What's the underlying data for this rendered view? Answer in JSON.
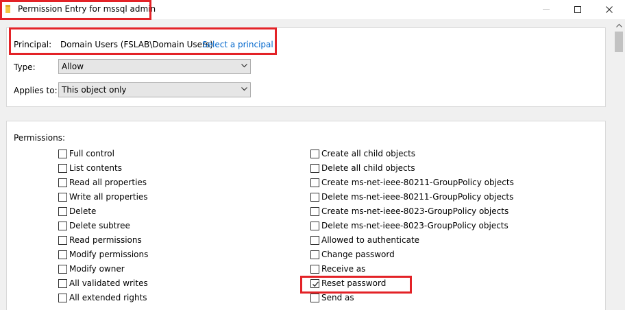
{
  "window": {
    "title": "Permission Entry for mssql admin"
  },
  "principal": {
    "label": "Principal:",
    "value": "Domain Users (FSLAB\\Domain Users)",
    "link": "Select a principal"
  },
  "type": {
    "label": "Type:",
    "value": "Allow"
  },
  "applies_to": {
    "label": "Applies to:",
    "value": "This object only"
  },
  "permissions": {
    "label": "Permissions:",
    "left": [
      {
        "label": "Full control",
        "checked": false
      },
      {
        "label": "List contents",
        "checked": false
      },
      {
        "label": "Read all properties",
        "checked": false
      },
      {
        "label": "Write all properties",
        "checked": false
      },
      {
        "label": "Delete",
        "checked": false
      },
      {
        "label": "Delete subtree",
        "checked": false
      },
      {
        "label": "Read permissions",
        "checked": false
      },
      {
        "label": "Modify permissions",
        "checked": false
      },
      {
        "label": "Modify owner",
        "checked": false
      },
      {
        "label": "All validated writes",
        "checked": false
      },
      {
        "label": "All extended rights",
        "checked": false
      }
    ],
    "right": [
      {
        "label": "Create all child objects",
        "checked": false
      },
      {
        "label": "Delete all child objects",
        "checked": false
      },
      {
        "label": "Create ms-net-ieee-80211-GroupPolicy objects",
        "checked": false
      },
      {
        "label": "Delete ms-net-ieee-80211-GroupPolicy objects",
        "checked": false
      },
      {
        "label": "Create ms-net-ieee-8023-GroupPolicy objects",
        "checked": false
      },
      {
        "label": "Delete ms-net-ieee-8023-GroupPolicy objects",
        "checked": false
      },
      {
        "label": "Allowed to authenticate",
        "checked": false
      },
      {
        "label": "Change password",
        "checked": false
      },
      {
        "label": "Receive as",
        "checked": false
      },
      {
        "label": "Reset password",
        "checked": true
      },
      {
        "label": "Send as",
        "checked": false
      }
    ]
  },
  "colors": {
    "highlight": "#e32227",
    "link": "#0066cc",
    "folder": "#f4c542"
  },
  "icons": {
    "folder": "folder-icon",
    "minimize": "minimize-icon",
    "maximize": "maximize-icon",
    "close": "close-icon"
  }
}
